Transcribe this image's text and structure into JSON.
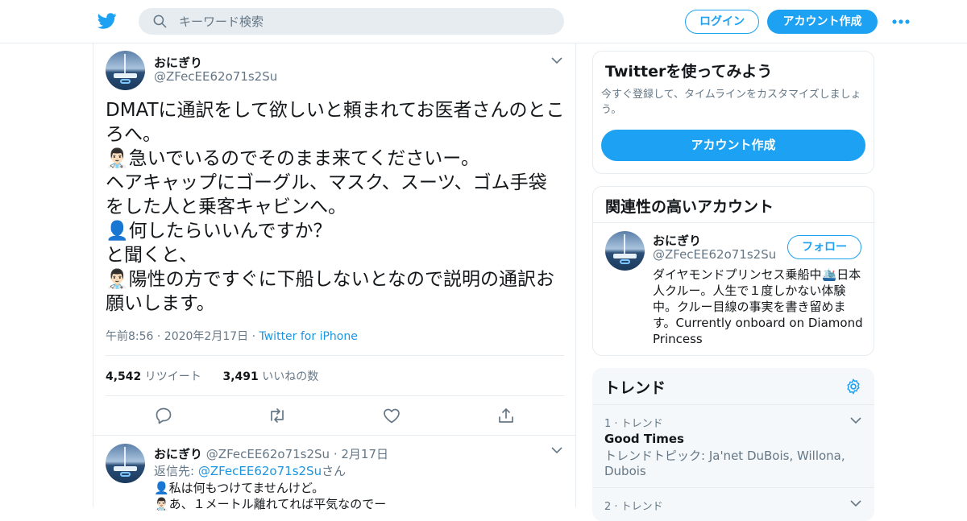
{
  "header": {
    "search_placeholder": "キーワード検索",
    "login_label": "ログイン",
    "signup_label": "アカウント作成"
  },
  "tweet": {
    "name": "おにぎり",
    "handle": "@ZFecEE62o71s2Su",
    "text": "DMATに通訳をして欲しいと頼まれてお医者さんのところへ。\n👨🏻‍⚕️急いでいるのでそのまま来てくださいー。\nヘアキャップにゴーグル、マスク、スーツ、ゴム手袋をした人と乗客キャビンへ。\n👤何したらいいんですか？\nと聞くと、\n👨🏻‍⚕️陽性の方ですぐに下船しないとなので説明の通訳お願いします。",
    "time": "午前8:56 · 2020年2月17日",
    "sep": " · ",
    "source": "Twitter for iPhone",
    "retweet_count": "4,542",
    "retweet_label": " リツイート",
    "like_count": "3,491",
    "like_label": " いいねの数"
  },
  "reply": {
    "name": "おにぎり",
    "handle": "@ZFecEE62o71s2Su",
    "date": "· 2月17日",
    "reply_prefix": "返信先: ",
    "reply_to": "@ZFecEE62o71s2Su",
    "reply_suffix": "さん",
    "line1": "👤私は何もつけてませんけど。",
    "line2": "👨🏻‍⚕️あ、１メートル離れてれば平気なのでー"
  },
  "try_card": {
    "title": "Twitterを使ってみよう",
    "desc": "今すぐ登録して、タイムラインをカスタマイズしましょう。",
    "button": "アカウント作成"
  },
  "related": {
    "title": "関連性の高いアカウント",
    "name": "おにぎり",
    "handle": "@ZFecEE62o71s2Su",
    "follow": "フォロー",
    "bio": "ダイヤモンドプリンセス乗船中🛳️日本人クルー。人生で１度しかない体験中。クルー目線の事実を書き留めます。Currently onboard on Diamond Princess"
  },
  "trends": {
    "title": "トレンド",
    "items": [
      {
        "rank": "1 · トレンド",
        "name": "Good Times",
        "sub": "トレンドトピック: Ja'net DuBois, Willona, Dubois"
      },
      {
        "rank": "2 · トレンド"
      }
    ]
  },
  "colors": {
    "accent": "#1da1f2",
    "link": "#1b95e0",
    "muted": "#657786"
  }
}
